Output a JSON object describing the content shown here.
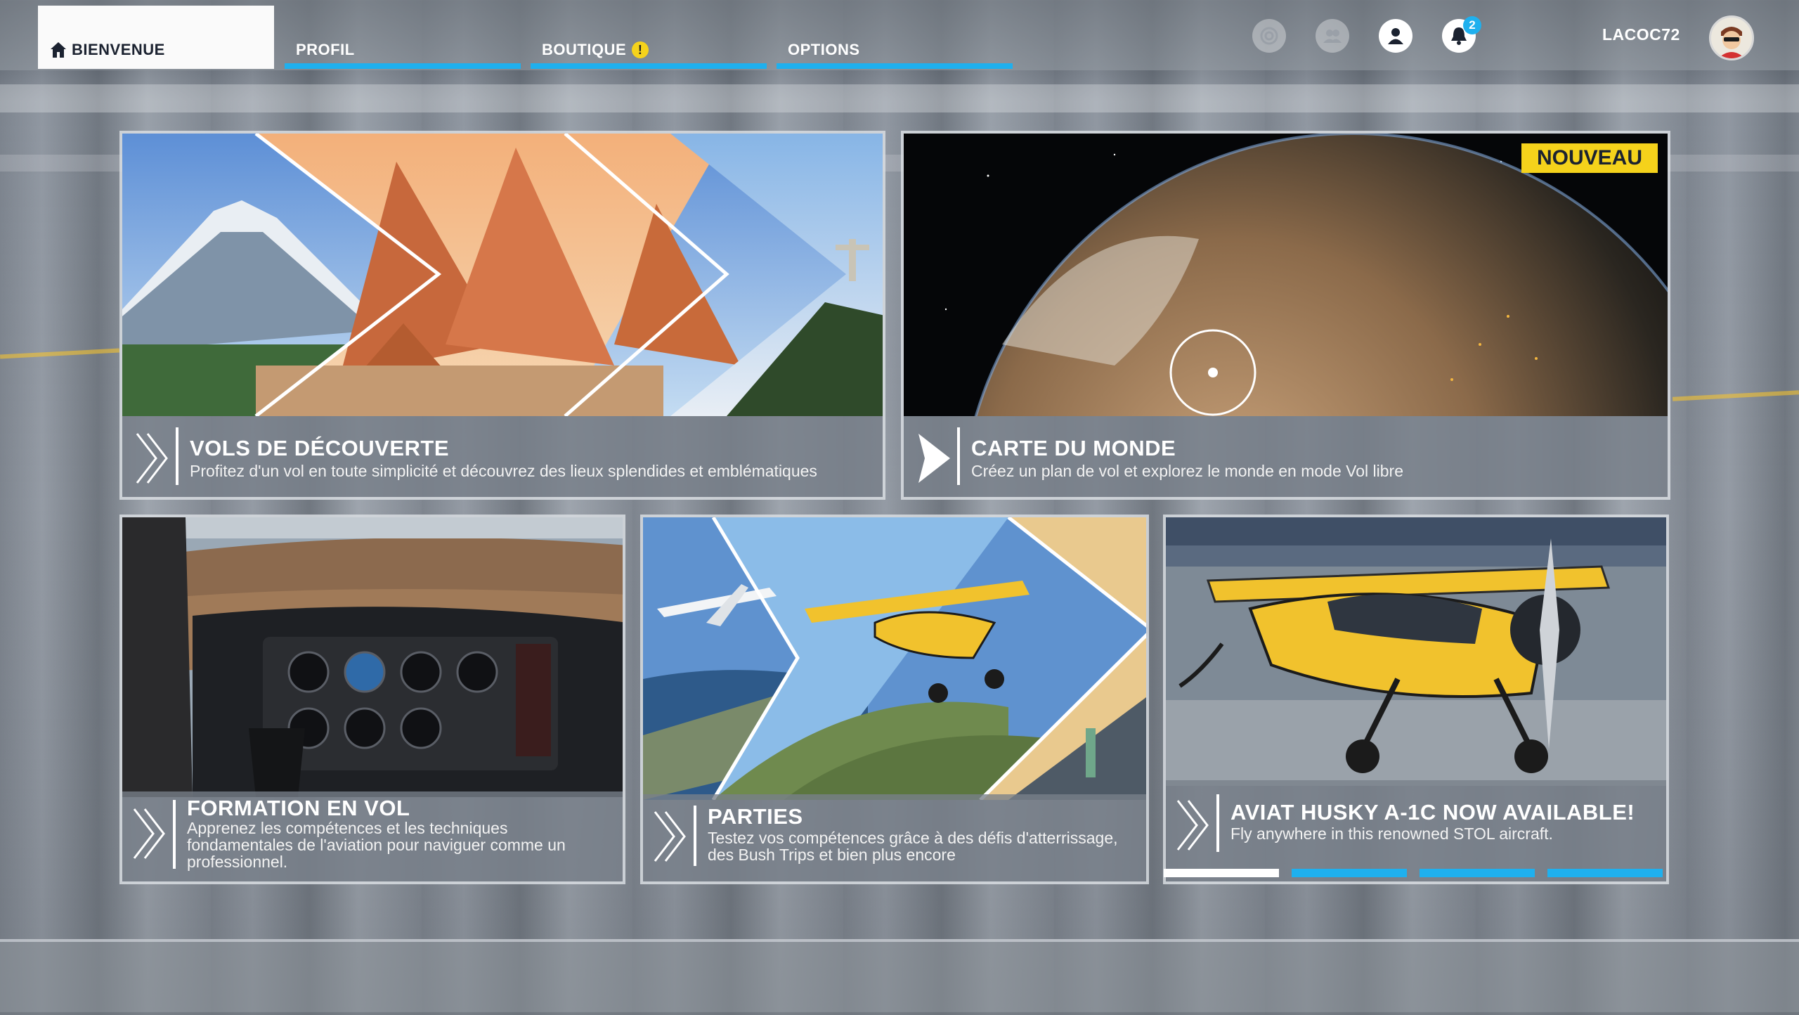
{
  "nav": {
    "tabs": [
      {
        "label": "BIENVENUE",
        "active": true
      },
      {
        "label": "PROFIL",
        "active": false
      },
      {
        "label": "BOUTIQUE",
        "active": false,
        "badge": "!"
      },
      {
        "label": "OPTIONS",
        "active": false
      }
    ],
    "notifications_count": "2",
    "username": "LACOC72"
  },
  "cards": {
    "discovery": {
      "title": "VOLS DE DÉCOUVERTE",
      "desc": "Profitez d'un vol en toute simplicité et découvrez des lieux splendides et emblématiques"
    },
    "world_map": {
      "title": "CARTE DU MONDE",
      "desc": "Créez un plan de vol et explorez le monde en mode Vol libre",
      "badge": "NOUVEAU"
    },
    "training": {
      "title": "FORMATION EN VOL",
      "desc": "Apprenez les compétences et les techniques fondamentales de l'aviation pour naviguer comme un professionnel."
    },
    "activities": {
      "title": "PARTIES",
      "desc": "Testez vos compétences grâce à des défis d'atterrissage, des Bush Trips et bien plus encore"
    },
    "featured": {
      "title": "AVIAT HUSKY A-1C NOW AVAILABLE!",
      "desc": "Fly anywhere in this renowned STOL aircraft."
    }
  },
  "carousel": {
    "count": 4,
    "active_index": 0
  },
  "colors": {
    "accent": "#1fb0ee",
    "badge": "#f5d21b",
    "active_tab": "#fafafa"
  }
}
